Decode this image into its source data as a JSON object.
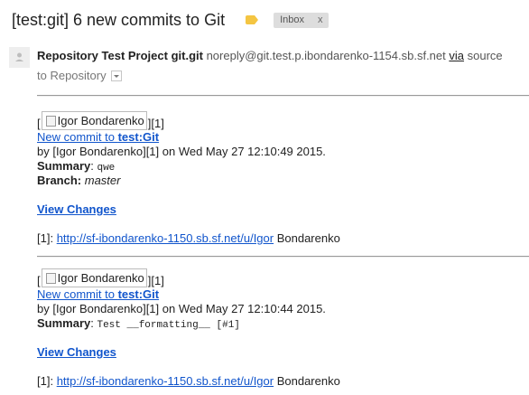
{
  "header": {
    "subject": "[test:git] 6 new commits to Git",
    "label_tag_icon": "label-tag-icon",
    "inbox_label": "Inbox",
    "inbox_remove": "x"
  },
  "message": {
    "avatar_icon": "person-icon",
    "sender_name": "Repository Test Project git.git",
    "sender_email": "noreply@git.test.p.ibondarenko-1154.sb.sf.net",
    "via_label": "via",
    "source_label": "source",
    "to_label": "to Repository",
    "details_icon": "dropdown-arrow-icon"
  },
  "commits": [
    {
      "bracket_open": "[",
      "image_alt": "Igor Bondarenko",
      "bracket_ref": "][1]",
      "link_prefix": "New commit to ",
      "link_repo": "test:Git",
      "byline": "by [Igor Bondarenko][1] on Wed May 27 12:10:49 2015.",
      "summary_label": "Summary",
      "summary_colon": ": ",
      "summary_value": "qwe",
      "branch_label": "Branch:",
      "branch_value": "master",
      "view_changes": "View Changes",
      "ref_label": "[1]: ",
      "ref_url": "http://sf-ibondarenko-1150.sb.sf.net/u/Igor",
      "ref_suffix": " Bondarenko"
    },
    {
      "bracket_open": "[",
      "image_alt": "Igor Bondarenko",
      "bracket_ref": "][1]",
      "link_prefix": "New commit to ",
      "link_repo": "test:Git",
      "byline": "by [Igor Bondarenko][1] on Wed May 27 12:10:44 2015.",
      "summary_label": "Summary",
      "summary_colon": ": ",
      "summary_value": "Test __formatting__ [#1]",
      "view_changes": "View Changes",
      "ref_label": "[1]: ",
      "ref_url": "http://sf-ibondarenko-1150.sb.sf.net/u/Igor",
      "ref_suffix": " Bondarenko"
    }
  ],
  "colors": {
    "link": "#1155cc",
    "label_tag": "#f4c542",
    "inbox_chip_bg": "#dddddd"
  }
}
